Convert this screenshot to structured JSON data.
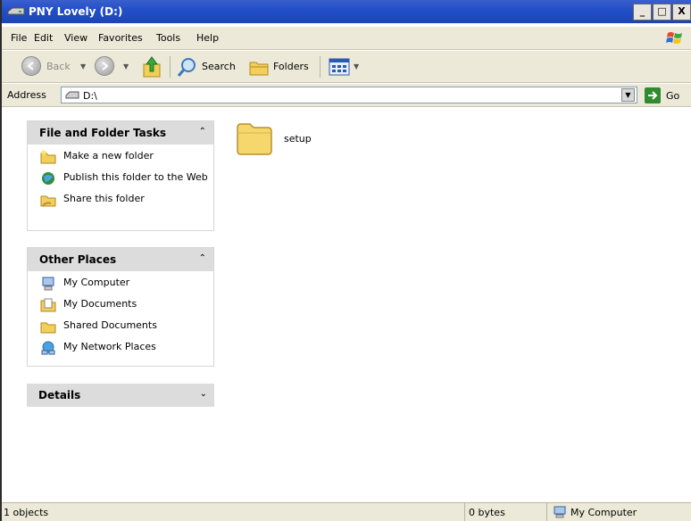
{
  "window": {
    "title": "PNY Lovely (D:)",
    "controls": {
      "minimize": "_",
      "maximize": "□",
      "close": "X"
    }
  },
  "menu": [
    "File",
    "Edit",
    "View",
    "Favorites",
    "Tools",
    "Help"
  ],
  "toolbar": {
    "back_label": "Back",
    "search_label": "Search",
    "folders_label": "Folders",
    "views_icon": "views-icon"
  },
  "address": {
    "label": "Address",
    "value": "D:\\",
    "go_label": "Go"
  },
  "tasks": {
    "file_folder": {
      "title": "File and Folder Tasks",
      "items": [
        {
          "label": "Make a new folder",
          "icon": "new-folder-icon"
        },
        {
          "label": "Publish this folder to the Web",
          "icon": "publish-web-icon"
        },
        {
          "label": "Share this folder",
          "icon": "share-folder-icon"
        }
      ]
    },
    "other_places": {
      "title": "Other Places",
      "items": [
        {
          "label": "My Computer",
          "icon": "my-computer-icon"
        },
        {
          "label": "My Documents",
          "icon": "my-documents-icon"
        },
        {
          "label": "Shared Documents",
          "icon": "shared-documents-icon"
        },
        {
          "label": "My Network Places",
          "icon": "network-places-icon"
        }
      ]
    },
    "details": {
      "title": "Details"
    }
  },
  "files": [
    {
      "name": "setup",
      "type": "folder"
    }
  ],
  "status": {
    "objects": "1 objects",
    "size": "0 bytes",
    "location": "My Computer"
  },
  "colors": {
    "titlebar": "#2350c8",
    "chrome": "#ece9d8",
    "pane_header": "#dcdcdc",
    "folder": "#f5d76e"
  }
}
